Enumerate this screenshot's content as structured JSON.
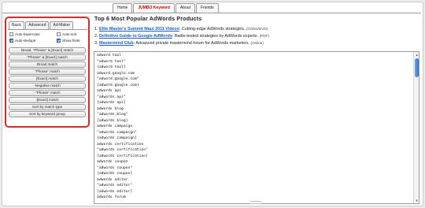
{
  "nav": {
    "tabs": [
      {
        "label": "Home"
      },
      {
        "label": "JUMBO Keyword"
      },
      {
        "label": "About"
      },
      {
        "label": "Friends"
      }
    ]
  },
  "panel": {
    "tabs": [
      {
        "label": "Basic"
      },
      {
        "label": "Advanced"
      },
      {
        "label": "Ad-Maker"
      }
    ],
    "options": [
      {
        "label": "Auto-lowercase",
        "checked": false
      },
      {
        "label": "Auto-sort",
        "checked": false
      },
      {
        "label": "Auto-dedupe",
        "checked": true
      },
      {
        "label": "Show hints",
        "checked": true
      }
    ],
    "buttons": [
      "Broad, \"Phrase\" & [Exact] match",
      "\"Phrase\" & [Exact] match",
      "Broad match",
      "\"Phrase\" match",
      "[Exact] match",
      "-Negative match",
      "-\"Phrase\" match",
      "-[Exact] match",
      "Sort by match type",
      "Sort by keyword group"
    ]
  },
  "products": {
    "heading": "Top 6 Most Popular AdWords Products",
    "items": [
      {
        "num": "1.",
        "link": "Elite Master's Summit Maui 2011 Videos",
        "desc": ": Cutting-edge AdWords strategies.",
        "meta": "(Online/DVD)"
      },
      {
        "num": "2.",
        "link": "Definitive Guide to Google AdWords",
        "desc": ": Battle-tested strategies by AdWords experts.",
        "meta": "(PDF)"
      },
      {
        "num": "3.",
        "link": "Mastermind Club",
        "desc": ": Advanced private mastermind forum for AdWords marketers.",
        "meta": "(Online)"
      }
    ]
  },
  "editor": {
    "lines": [
      "adword tool",
      "\"adword tool\"",
      "[adword tool]",
      "adword.google.com",
      "\"adword.google.com\"",
      "[adword.google.com]",
      "adwords api",
      "\"adwords api\"",
      "[adwords api]",
      "adwords blog",
      "\"adwords blog\"",
      "[adwords blog]",
      "adwords campaign",
      "\"adwords campaign\"",
      "[adwords campaign]",
      "adwords certification",
      "\"adwords certification\"",
      "[adwords certification]",
      "adwords coupon",
      "\"adwords coupon\"",
      "[adwords coupon]",
      "adwords editor",
      "\"adwords editor\"",
      "[adwords editor]",
      "adwords forum"
    ]
  },
  "colors": {
    "accent_red": "#d12e2e",
    "link_blue": "#1d5fb8",
    "scroll_blue": "#2f74d4"
  }
}
